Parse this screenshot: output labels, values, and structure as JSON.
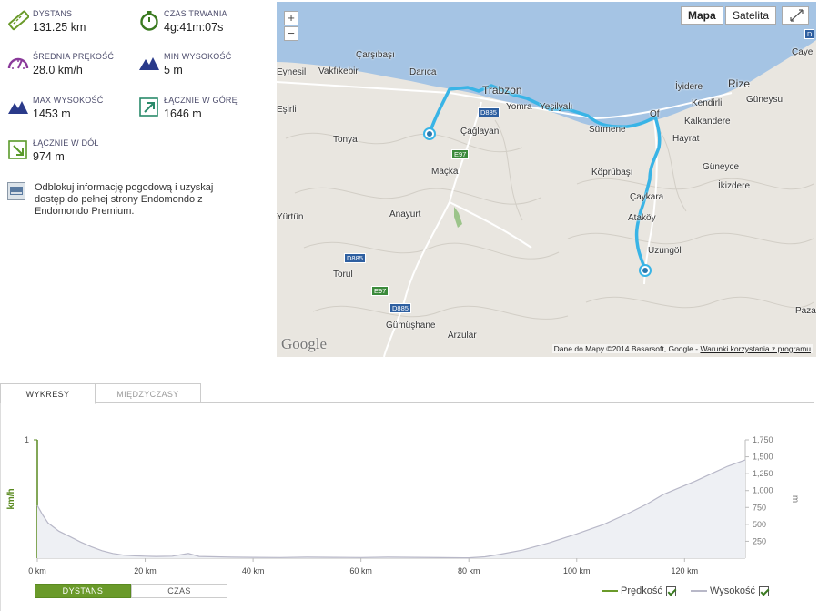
{
  "stats": [
    {
      "key": "distance",
      "label": "DYSTANS",
      "value": "131.25 km",
      "icon": "ruler-icon"
    },
    {
      "key": "duration",
      "label": "CZAS TRWANIA",
      "value": "4g:41m:07s",
      "icon": "stopwatch-icon"
    },
    {
      "key": "avg_speed",
      "label": "ŚREDNIA PRĘKOŚĆ",
      "value": "28.0 km/h",
      "icon": "speedometer-icon"
    },
    {
      "key": "min_alt",
      "label": "MIN WYSOKOŚĆ",
      "value": "5 m",
      "icon": "mountain-icon"
    },
    {
      "key": "max_alt",
      "label": "MAX WYSOKOŚĆ",
      "value": "1453 m",
      "icon": "mountain-icon"
    },
    {
      "key": "ascent",
      "label": "ŁĄCZNIE W GÓRĘ",
      "value": "1646 m",
      "icon": "arrow-up-right-icon"
    },
    {
      "key": "descent",
      "label": "ŁĄCZNIE W DÓŁ",
      "value": "974 m",
      "icon": "arrow-down-right-icon"
    }
  ],
  "premium_text": "Odblokuj informację pogodową i uzyskaj dostęp do pełnej strony Endomondo z Endomondo Premium.",
  "map": {
    "zoom_in": "+",
    "zoom_out": "−",
    "type_map": "Mapa",
    "type_satellite": "Satelita",
    "google_logo": "Google",
    "attribution": "Dane do Mapy ©2014 Basarsoft, Google - ",
    "terms_link": "Warunki korzystania z programu",
    "places": [
      "Çarşıbaşı",
      "Eynesil",
      "Vakfıkebir",
      "Darıca",
      "Trabzon",
      "Yomra",
      "Yeşilyalı",
      "Sürmene",
      "Of",
      "İyidere",
      "Rize",
      "Kendirli",
      "Güneysu",
      "Kalkandere",
      "Hayrat",
      "Güneyce",
      "İkizdere",
      "Köprübaşı",
      "Çaykara",
      "Ataköy",
      "Uzungöl",
      "Tonya",
      "Çağlayan",
      "Maçka",
      "Anayurt",
      "Torul",
      "Gümüşhane",
      "Arzular",
      "Eşirli",
      "Yürtün",
      "Çaye",
      "Paza"
    ],
    "roads": [
      "D885",
      "E97",
      "D885",
      "E97",
      "D885",
      "D885"
    ],
    "road_top_right": "D"
  },
  "tabs": {
    "charts": "WYKRESY",
    "splits": "MIĘDZYCZASY"
  },
  "chart_data": {
    "type": "area",
    "x_unit": "km",
    "x_ticks": [
      "0 km",
      "20 km",
      "40 km",
      "60 km",
      "80 km",
      "100 km",
      "120 km"
    ],
    "xlim": [
      0,
      131.25
    ],
    "left_axis": {
      "label": "km/h",
      "tick": "1",
      "color": "#5a8a20"
    },
    "right_axis": {
      "label": "m",
      "ticks": [
        "250",
        "500",
        "750",
        "1,000",
        "1,250",
        "1,500",
        "1,750"
      ],
      "ylim": [
        0,
        1750
      ]
    },
    "series": [
      {
        "name": "Wysokość",
        "color": "#b8b8c8",
        "x": [
          0,
          1,
          2,
          4,
          6,
          8,
          10,
          12,
          14,
          16,
          18,
          20,
          22,
          25,
          28,
          30,
          33,
          36,
          40,
          45,
          50,
          55,
          60,
          65,
          70,
          75,
          80,
          83,
          86,
          90,
          95,
          100,
          105,
          110,
          113,
          116,
          119,
          122,
          125,
          128,
          131.25
        ],
        "y": [
          780,
          640,
          520,
          400,
          320,
          240,
          170,
          110,
          70,
          45,
          35,
          30,
          25,
          30,
          70,
          25,
          20,
          15,
          12,
          10,
          15,
          12,
          10,
          15,
          12,
          8,
          5,
          20,
          60,
          120,
          230,
          360,
          500,
          680,
          800,
          940,
          1040,
          1140,
          1250,
          1360,
          1453
        ]
      }
    ],
    "speed_legend": "Prędkość",
    "altitude_legend": "Wysokość",
    "x_toggle_distance": "DYSTANS",
    "x_toggle_time": "CZAS"
  }
}
